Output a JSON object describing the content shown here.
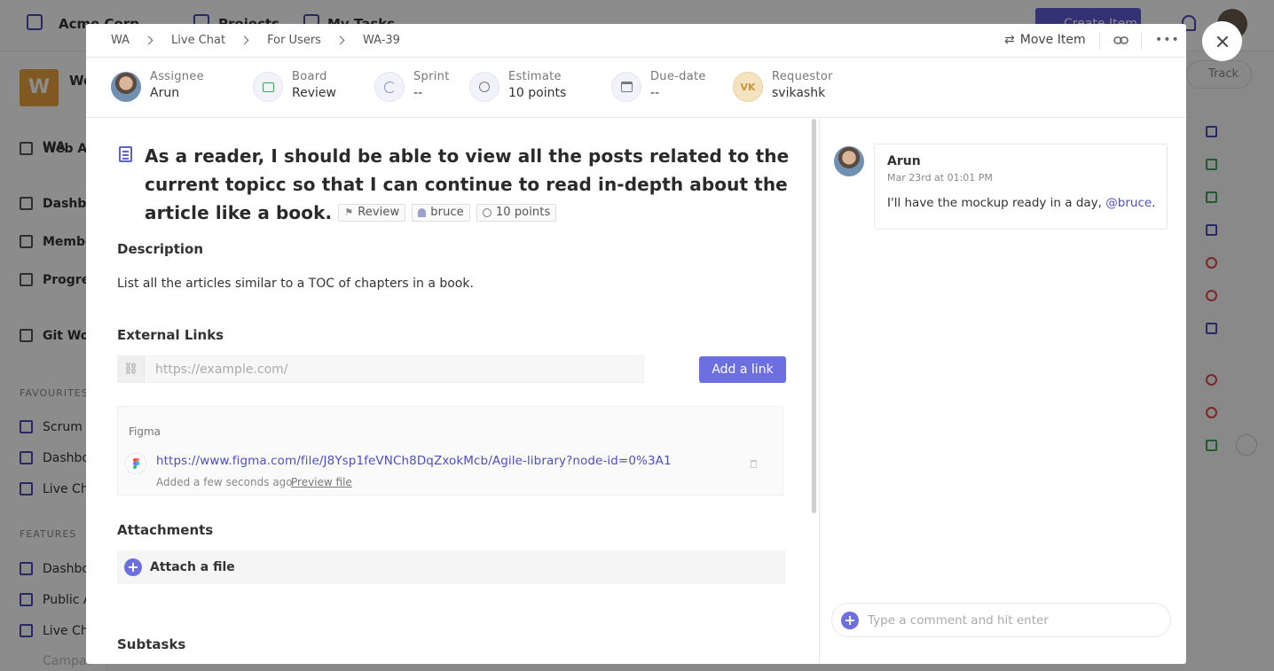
{
  "background": {
    "org": "Acme Corp",
    "nav_projects": "Projects",
    "nav_tasks": "My Tasks",
    "create_label": "Create Item",
    "logo_letter": "W",
    "project_name": "We",
    "project_sub": "WA",
    "sidebar": [
      "Web Ap",
      "Dashbo",
      "Membe",
      "Progres",
      "Git Wor"
    ],
    "favourites_head": "FAVOURITES",
    "favourites": [
      "Scrum B",
      "Dashbo",
      "Live Ch"
    ],
    "features_head": "FEATURES",
    "features": [
      "Dashbo",
      "Public A",
      "Live Cha",
      "Campai"
    ],
    "track_label": "Track"
  },
  "breadcrumb": [
    "WA",
    "Live Chat",
    "For Users",
    "WA-39"
  ],
  "toolbar": {
    "move_label": "Move Item",
    "link_icon": "link-icon",
    "more_icon": "more-icon"
  },
  "meta": {
    "assignee": {
      "label": "Assignee",
      "value": "Arun"
    },
    "board": {
      "label": "Board",
      "value": "Review"
    },
    "sprint": {
      "label": "Sprint",
      "value": "--"
    },
    "estimate": {
      "label": "Estimate",
      "value": "10 points"
    },
    "due": {
      "label": "Due-date",
      "value": "--"
    },
    "requestor": {
      "label": "Requestor",
      "value": "svikashk",
      "initials": "VK"
    }
  },
  "item": {
    "title": "As a reader, I should be able to view all the posts related to the current topicc so that I can continue to read in-depth about the article like a book.",
    "chip_status": "Review",
    "chip_user": "bruce",
    "chip_points": "10 points",
    "description_head": "Description",
    "description": "List all the articles similar to a TOC of chapters in a book.",
    "links_head": "External Links",
    "link_placeholder": "https://example.com/",
    "add_link_label": "Add a link",
    "link_source": "Figma",
    "link_url": "https://www.figma.com/file/J8Ysp1feVNCh8DqZxokMcb/Agile-library?node-id=0%3A1",
    "link_added": "Added a few seconds ago",
    "link_preview": "Preview file",
    "attachments_head": "Attachments",
    "attach_label": "Attach a file",
    "subtasks_head": "Subtasks"
  },
  "comments": {
    "author": "Arun",
    "time": "Mar 23rd at 01:01 PM",
    "text": "I'll have the mockup ready in a day, ",
    "mention": "@bruce",
    "text_end": ".",
    "input_placeholder": "Type a comment and hit enter"
  },
  "colors": {
    "accent": "#6b6fe0",
    "link": "#4b50c9"
  }
}
